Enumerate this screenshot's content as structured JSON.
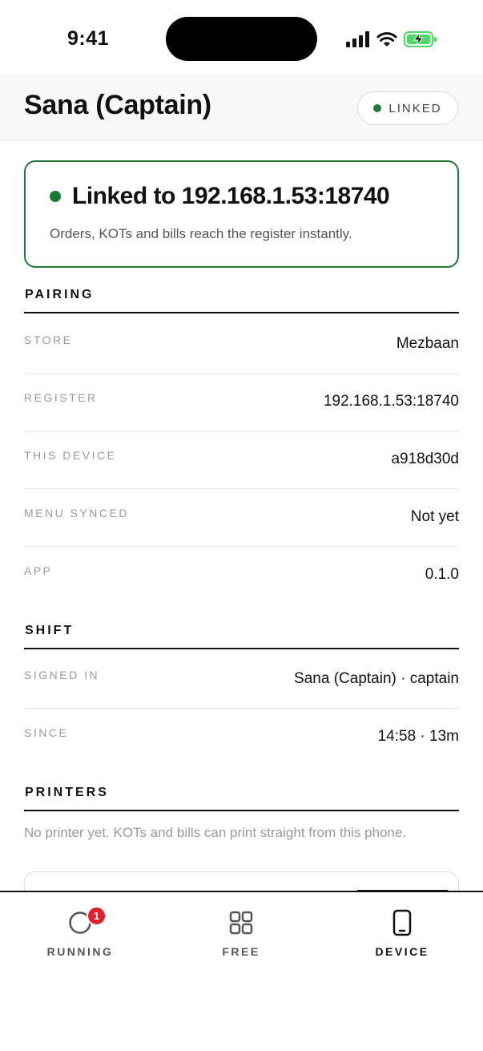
{
  "status_bar": {
    "time": "9:41"
  },
  "header": {
    "title": "Sana (Captain)",
    "link_status": "LINKED"
  },
  "linked_card": {
    "title": "Linked to 192.168.1.53:18740",
    "subtitle": "Orders, KOTs and bills reach the register instantly."
  },
  "pairing": {
    "title": "PAIRING",
    "rows": [
      {
        "label": "STORE",
        "value": "Mezbaan"
      },
      {
        "label": "REGISTER",
        "value": "192.168.1.53:18740"
      },
      {
        "label": "THIS DEVICE",
        "value": "a918d30d"
      },
      {
        "label": "MENU SYNCED",
        "value": "Not yet"
      },
      {
        "label": "APP",
        "value": "0.1.0"
      }
    ]
  },
  "shift": {
    "title": "SHIFT",
    "rows": [
      {
        "label": "SIGNED IN",
        "value": "Sana (Captain) · captain"
      },
      {
        "label": "SINCE",
        "value": "14:58 · 13m"
      }
    ]
  },
  "printers": {
    "title": "PRINTERS",
    "note": "No printer yet. KOTs and bills can print straight from this phone."
  },
  "tabs": [
    {
      "label": "RUNNING",
      "icon": "circle-icon",
      "badge": "1",
      "active": false
    },
    {
      "label": "FREE",
      "icon": "grid-icon",
      "active": false
    },
    {
      "label": "DEVICE",
      "icon": "phone-icon",
      "active": true
    }
  ],
  "colors": {
    "accent_green": "#1c7a35",
    "badge_red": "#e0202a",
    "text": "#111111",
    "muted": "#9a9a9a"
  }
}
